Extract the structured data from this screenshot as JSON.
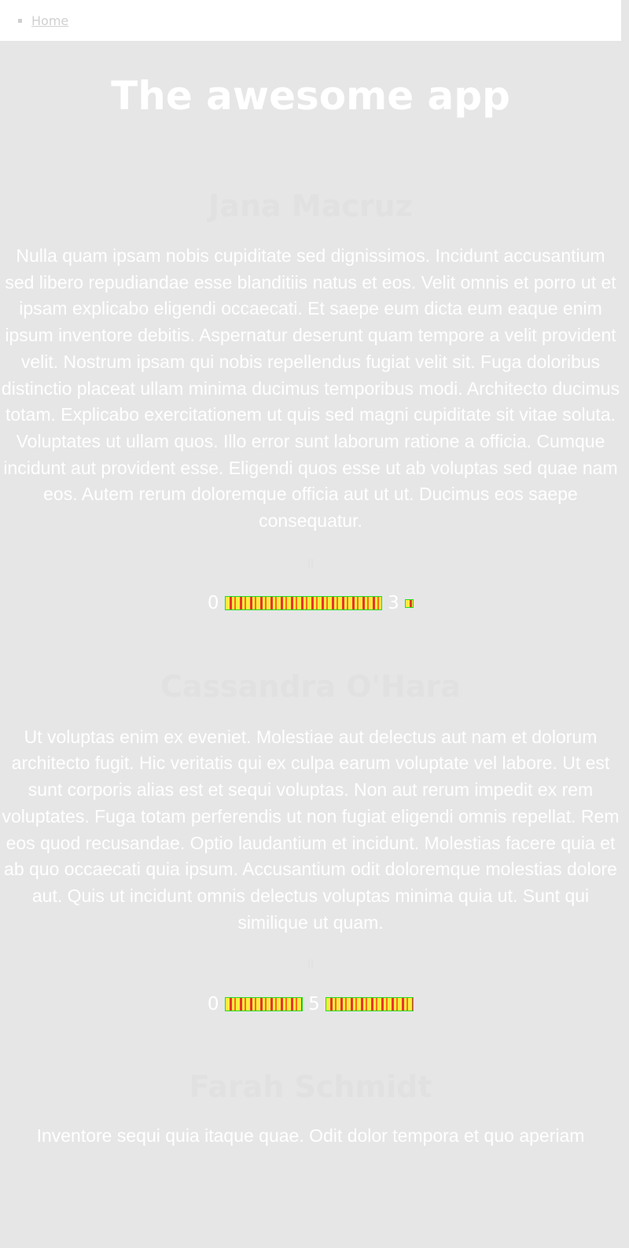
{
  "nav": {
    "home_label": "Home"
  },
  "header": {
    "title": "The awesome app"
  },
  "sections": [
    {
      "name": "Jana Macruz",
      "text": "Nulla quam ipsam nobis cupiditate sed dignissimos. Incidunt accusantium sed libero repudiandae esse blanditiis natus et eos. Velit omnis et porro ut et ipsam explicabo eligendi occaecati. Et saepe eum dicta eum eaque enim ipsum inventore debitis. Aspernatur deserunt quam tempore a velit provident velit. Nostrum ipsam qui nobis repellendus fugiat velit sit. Fuga doloribus distinctio placeat ullam minima ducimus temporibus modi. Architecto ducimus totam. Explicabo exercitationem ut quis sed magni cupiditate sit vitae soluta. Voluptates ut ullam quos. Illo error sunt laborum ratione a officia. Cumque incidunt aut provident esse. Eligendi quos esse ut ab voluptas sed quae nam eos. Autem rerum doloremque officia aut ut ut. Ducimus eos saepe consequatur.",
      "sep": "||",
      "rate_left": "0",
      "rate_mid": "3"
    },
    {
      "name": "Cassandra O'Hara",
      "text": "Ut voluptas enim ex eveniet. Molestiae aut delectus aut nam et dolorum architecto fugit. Hic veritatis qui ex culpa earum voluptate vel labore. Ut est sunt corporis alias est et sequi voluptas. Non aut rerum impedit ex rem voluptates. Fuga totam perferendis ut non fugiat eligendi omnis repellat. Rem eos quod recusandae. Optio laudantium et incidunt. Molestias facere quia et ab quo occaecati quia ipsum. Accusantium odit doloremque molestias dolore aut. Quis ut incidunt omnis delectus voluptas minima quia ut. Sunt qui similique ut quam.",
      "sep": "||",
      "rate_left": "0",
      "rate_mid": "5"
    },
    {
      "name": "Farah Schmidt",
      "text": "Inventore sequi quia itaque quae. Odit dolor tempora et quo aperiam"
    }
  ],
  "colors": {
    "page_bg": "#e6e6e6",
    "text": "#ffffff",
    "bar_yellow": "#f9ee3c",
    "bar_red": "#e7342f",
    "bar_border": "#22dd22"
  }
}
